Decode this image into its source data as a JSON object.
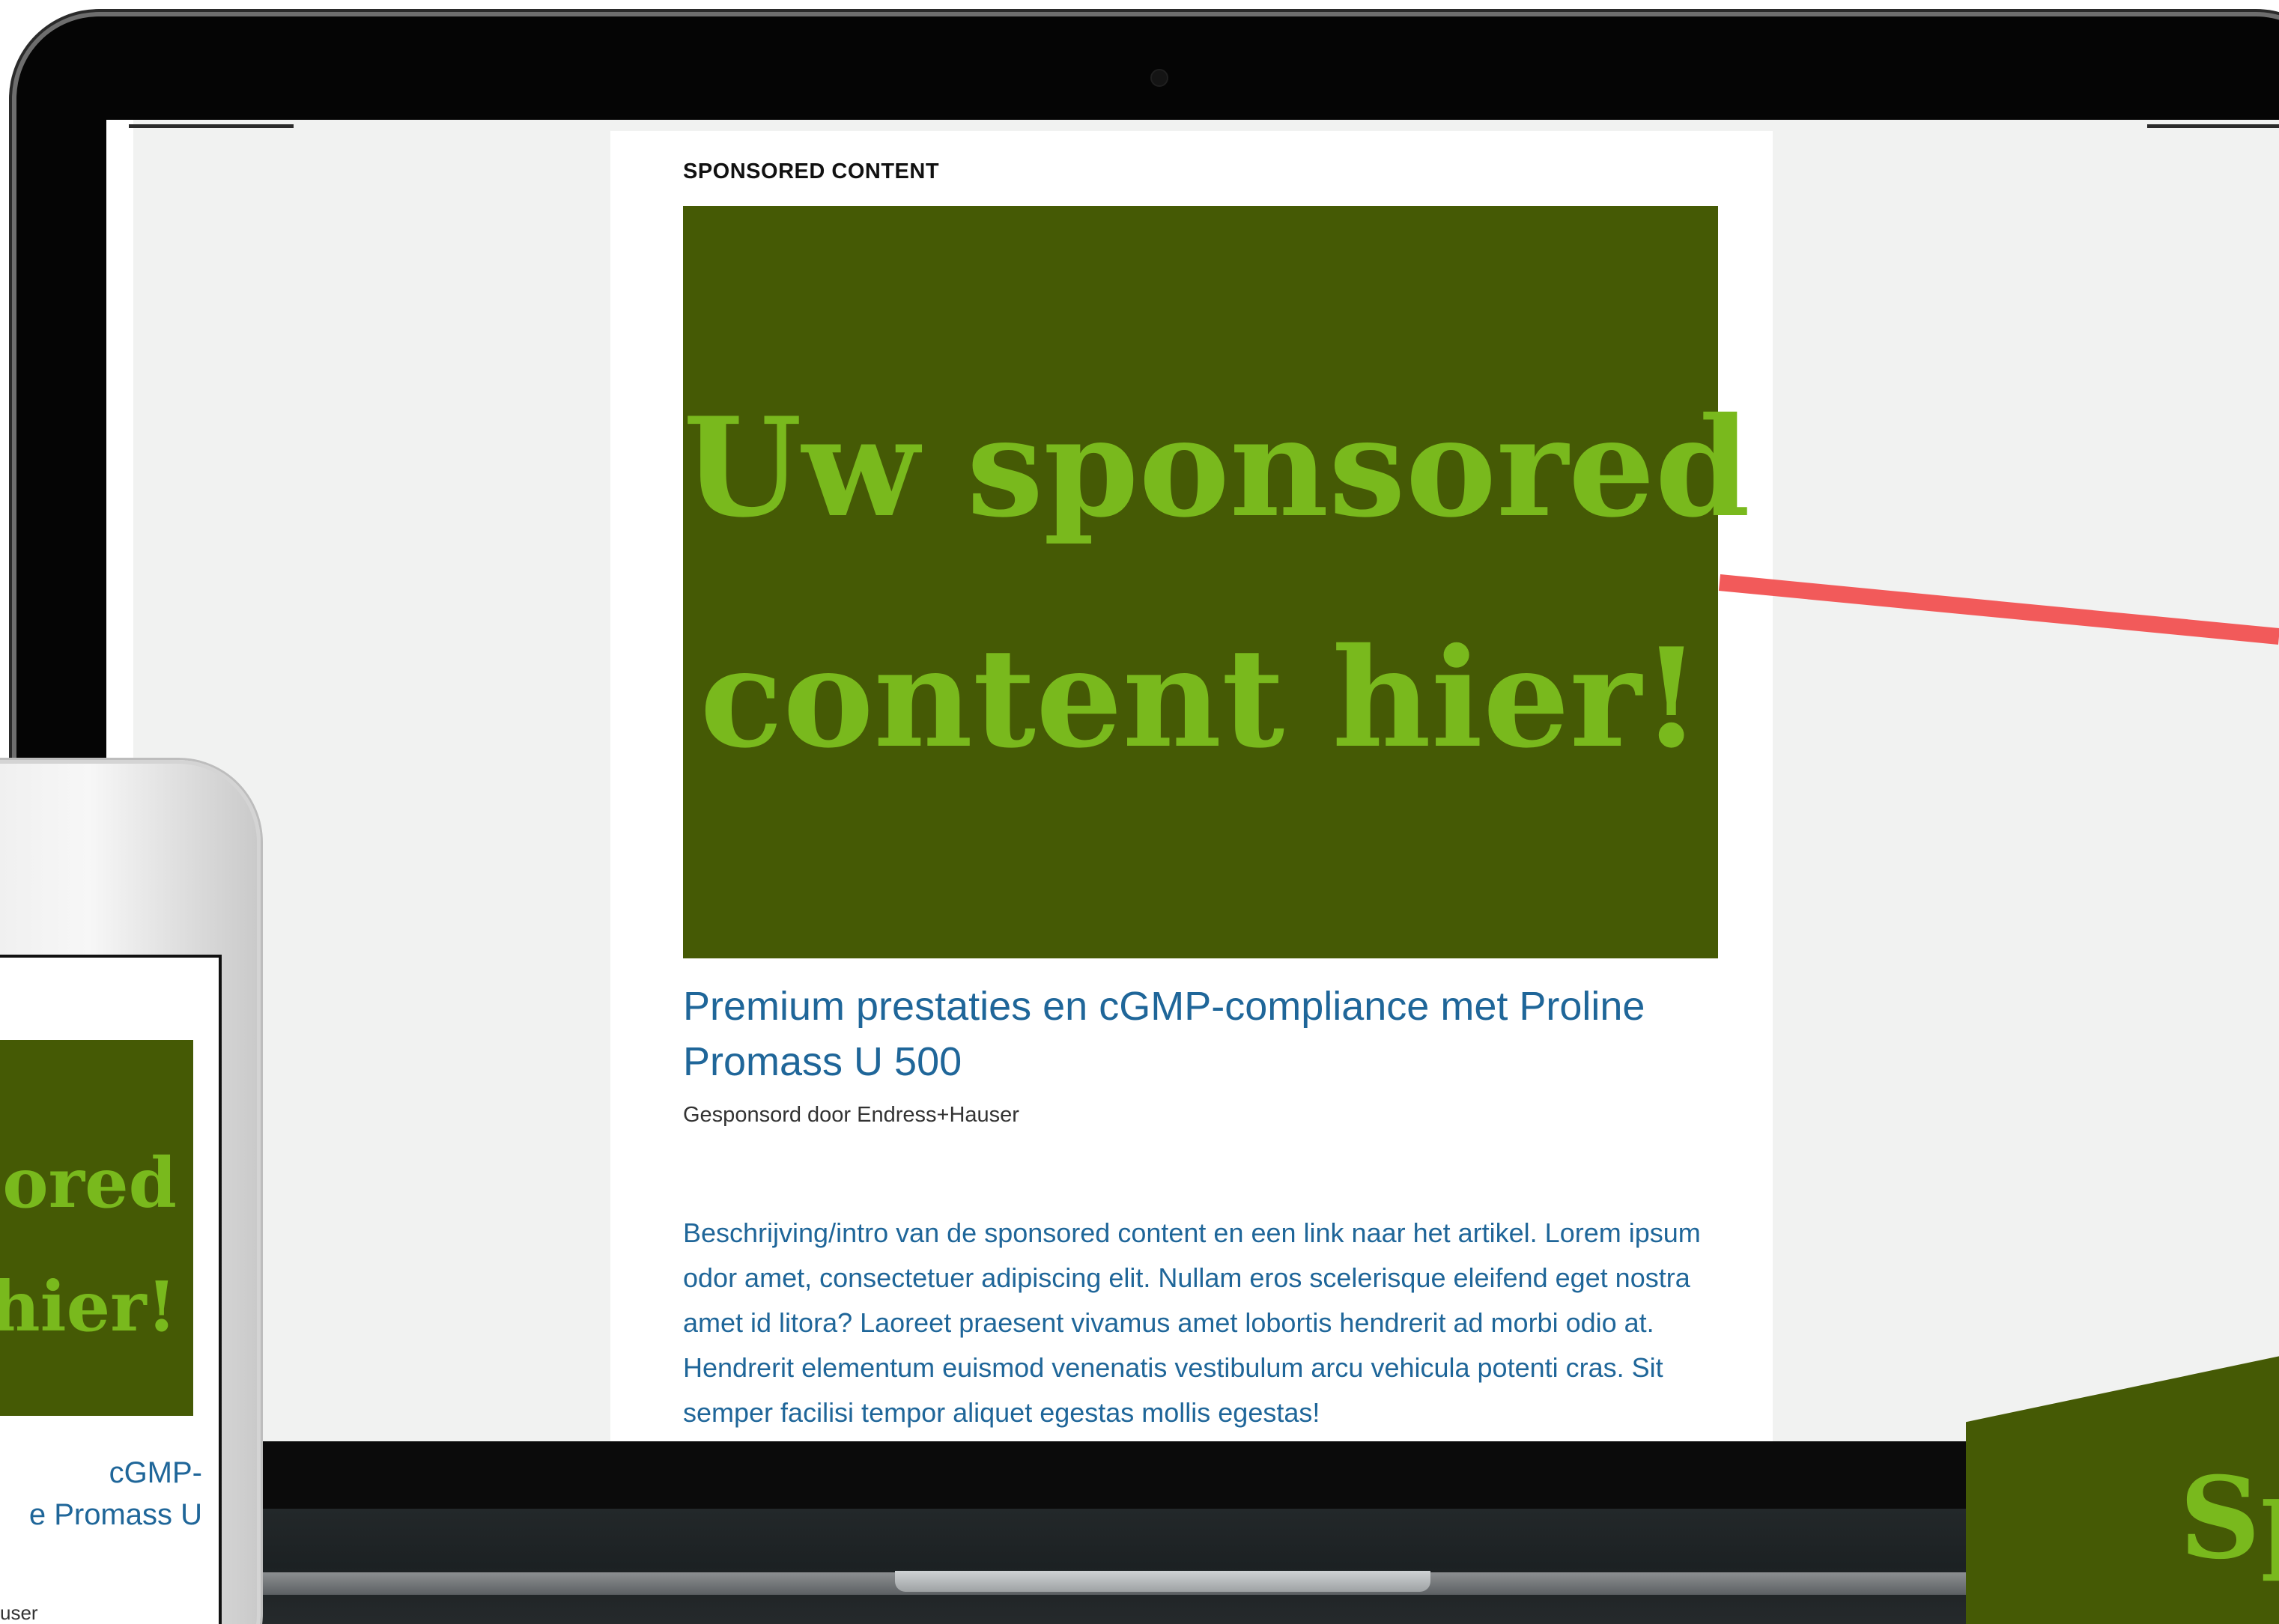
{
  "laptop": {
    "page": {
      "section_label": "SPONSORED CONTENT",
      "hero": {
        "line1": "Uw sponsored",
        "line2": "content hier!"
      },
      "article_title": "Premium prestaties en cGMP-compliance met Proline Promass U 500",
      "sponsor": "Gesponsord door Endress+Hauser",
      "body": "Beschrijving/intro van de sponsored content en een link naar het artikel. Lorem ipsum odor amet, consectetuer adipiscing elit. Nullam eros scelerisque eleifend eget nostra amet id litora? Laoreet praesent vivamus amet lobortis hendrerit ad morbi odio at. Hendrerit elementum euismod venenatis vestibulum arcu vehicula potenti cras. Sit semper facilisi tempor aliquet egestas mollis egestas!"
    }
  },
  "phone": {
    "hero": {
      "line1": "sored",
      "line2": "hier!"
    },
    "title_line1": "cGMP-",
    "title_line2": "e Promass U",
    "sponsor": "user"
  },
  "card_bottom_right": {
    "text": "Sp"
  },
  "colors": {
    "hero_bg": "#455a05",
    "hero_text": "#79b91d",
    "link_blue": "#1f6699",
    "callout_red": "#f25a5a",
    "page_bg": "#f1f2f1"
  }
}
